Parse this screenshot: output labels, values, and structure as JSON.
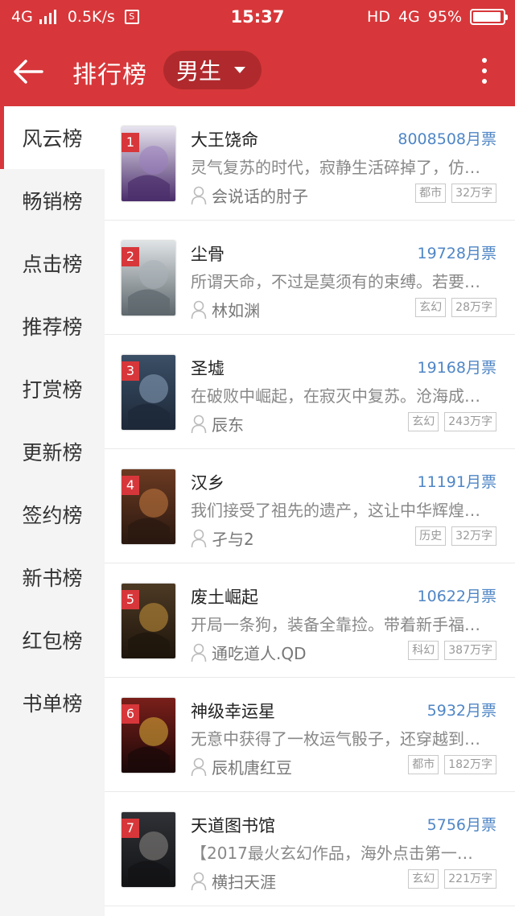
{
  "status_bar": {
    "network": "4G",
    "speed": "0.5K/s",
    "sim_icon": "S",
    "time": "15:37",
    "hd": "HD",
    "network_right": "4G",
    "battery_percent": "95%",
    "battery_level": 0.95
  },
  "header": {
    "back_icon": "arrow-left-icon",
    "title": "排行榜",
    "gender_selector": "男生",
    "more_icon": "more-vertical-icon"
  },
  "sidebar": {
    "items": [
      {
        "label": "风云榜",
        "active": true
      },
      {
        "label": "畅销榜",
        "active": false
      },
      {
        "label": "点击榜",
        "active": false
      },
      {
        "label": "推荐榜",
        "active": false
      },
      {
        "label": "打赏榜",
        "active": false
      },
      {
        "label": "更新榜",
        "active": false
      },
      {
        "label": "签约榜",
        "active": false
      },
      {
        "label": "新书榜",
        "active": false
      },
      {
        "label": "红包榜",
        "active": false
      },
      {
        "label": "书单榜",
        "active": false
      }
    ]
  },
  "colors": {
    "accent": "#d7373a",
    "tickets": "#4f86c6"
  },
  "books": [
    {
      "rank": "1",
      "title": "大王饶命",
      "tickets": "8008508月票",
      "desc": "灵气复苏的时代，寂静生活碎掉了，仿…",
      "author": "会说话的肘子",
      "genre": "都市",
      "words": "32万字"
    },
    {
      "rank": "2",
      "title": "尘骨",
      "tickets": "19728月票",
      "desc": "所谓天命，不过是莫须有的束缚。若要…",
      "author": "林如渊",
      "genre": "玄幻",
      "words": "28万字"
    },
    {
      "rank": "3",
      "title": "圣墟",
      "tickets": "19168月票",
      "desc": "在破败中崛起，在寂灭中复苏。沧海成…",
      "author": "辰东",
      "genre": "玄幻",
      "words": "243万字"
    },
    {
      "rank": "4",
      "title": "汉乡",
      "tickets": "11191月票",
      "desc": "我们接受了祖先的遗产，这让中华辉煌…",
      "author": "孑与2",
      "genre": "历史",
      "words": "32万字"
    },
    {
      "rank": "5",
      "title": "废土崛起",
      "tickets": "10622月票",
      "desc": "开局一条狗，装备全靠捡。带着新手福…",
      "author": "通吃道人.QD",
      "genre": "科幻",
      "words": "387万字"
    },
    {
      "rank": "6",
      "title": "神级幸运星",
      "tickets": "5932月票",
      "desc": "无意中获得了一枚运气骰子，还穿越到…",
      "author": "辰机唐红豆",
      "genre": "都市",
      "words": "182万字"
    },
    {
      "rank": "7",
      "title": "天道图书馆",
      "tickets": "5756月票",
      "desc": "【2017最火玄幻作品，海外点击第一…",
      "author": "横扫天涯",
      "genre": "玄幻",
      "words": "221万字"
    }
  ]
}
